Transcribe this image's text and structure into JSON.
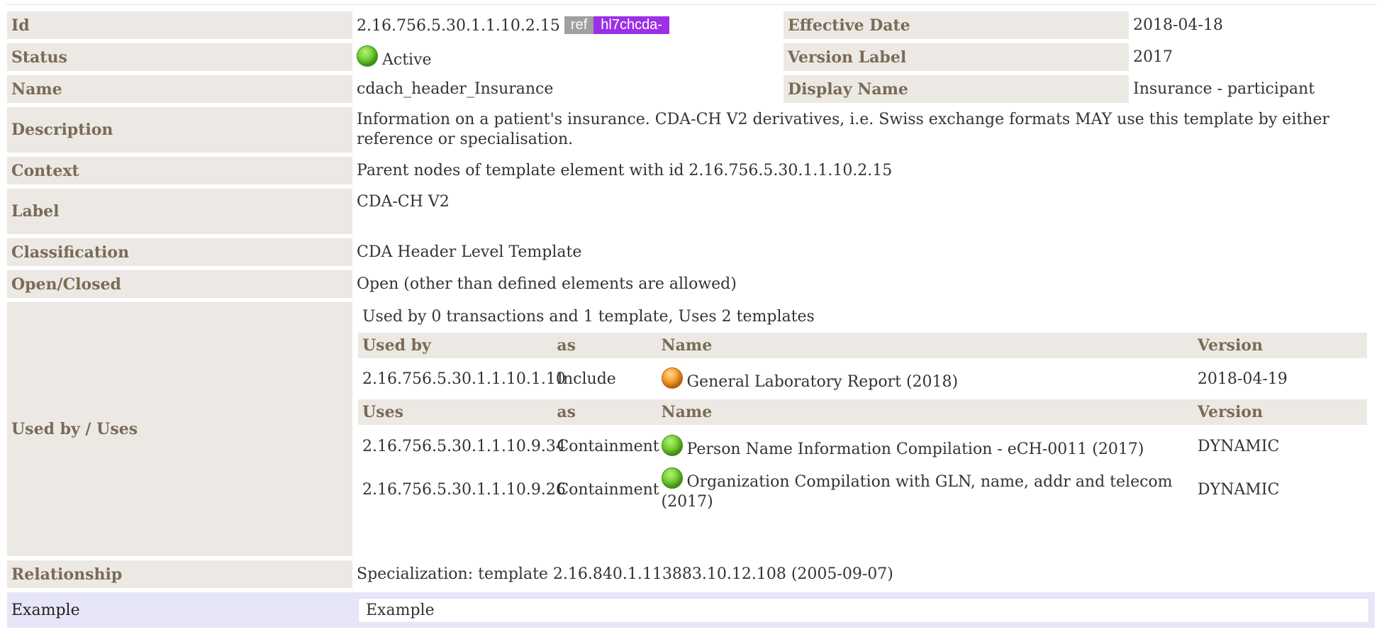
{
  "rows": {
    "id": {
      "label": "Id",
      "value": "2.16.756.5.30.1.1.10.2.15",
      "ref_badge": "ref",
      "prefix_badge": "hl7chcda-"
    },
    "effective_date": {
      "label": "Effective Date",
      "value": "2018-04-18"
    },
    "status": {
      "label": "Status",
      "value": "Active",
      "icon": "status-green-icon"
    },
    "version_label": {
      "label": "Version Label",
      "value": "2017"
    },
    "name": {
      "label": "Name",
      "value": "cdach_header_Insurance"
    },
    "display_name": {
      "label": "Display Name",
      "value": "Insurance - participant"
    },
    "description": {
      "label": "Description",
      "value": "Information on a patient's insurance. CDA-CH V2 derivatives, i.e. Swiss exchange formats MAY use this template by either reference or specialisation."
    },
    "context": {
      "label": "Context",
      "value": "Parent nodes of template element with id 2.16.756.5.30.1.1.10.2.15"
    },
    "label": {
      "label": "Label",
      "value": "CDA-CH V2"
    },
    "classification": {
      "label": "Classification",
      "value": "CDA Header Level Template"
    },
    "open_closed": {
      "label": "Open/Closed",
      "value": "Open (other than defined elements are allowed)"
    },
    "used_by_uses": {
      "label": "Used by / Uses",
      "summary": "Used by 0 transactions and 1 template, Uses 2 templates",
      "used_by_header": {
        "col1": "Used by",
        "col2": "as",
        "col3": "Name",
        "col4": "Version"
      },
      "used_by": [
        {
          "id": "2.16.756.5.30.1.1.10.1.10",
          "as": "Include",
          "name": "General Laboratory Report (2018)",
          "version": "2018-04-19",
          "status_color": "#f59a2a"
        }
      ],
      "uses_header": {
        "col1": "Uses",
        "col2": "as",
        "col3": "Name",
        "col4": "Version"
      },
      "uses": [
        {
          "id": "2.16.756.5.30.1.1.10.9.34",
          "as": "Containment",
          "name": "Person Name Information Compilation - eCH-0011 (2017)",
          "version": "DYNAMIC",
          "status_color": "#6fcf2c"
        },
        {
          "id": "2.16.756.5.30.1.1.10.9.26",
          "as": "Containment",
          "name": "Organization Compilation with GLN, name, addr and telecom (2017)",
          "version": "DYNAMIC",
          "status_color": "#6fcf2c"
        }
      ]
    },
    "relationship": {
      "label": "Relationship",
      "value": "Specialization: template 2.16.840.1.113883.10.12.108 (2005-09-07)"
    },
    "example": {
      "label": "Example",
      "value": "Example"
    }
  }
}
